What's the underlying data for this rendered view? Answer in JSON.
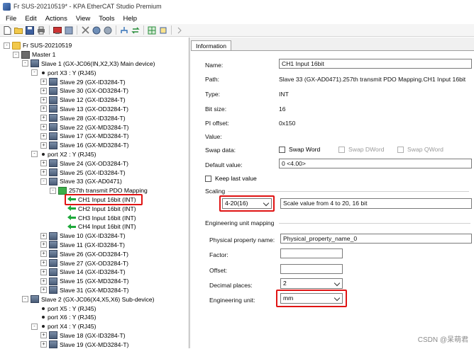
{
  "window": {
    "title": "Fr SUS-20210519* - KPA EtherCAT Studio Premium"
  },
  "menu": [
    {
      "label": "File",
      "name": "menu-file"
    },
    {
      "label": "Edit",
      "name": "menu-edit"
    },
    {
      "label": "Actions",
      "name": "menu-actions"
    },
    {
      "label": "View",
      "name": "menu-view"
    },
    {
      "label": "Tools",
      "name": "menu-tools"
    },
    {
      "label": "Help",
      "name": "menu-help"
    }
  ],
  "tree": [
    {
      "label": "Fr SUS-20210519",
      "icon": "folder",
      "depth": 0,
      "exp": "-"
    },
    {
      "label": "Master 1",
      "icon": "master",
      "depth": 1,
      "exp": "-"
    },
    {
      "label": "Slave 1 (GX-JC06(IN,X2,X3) Main device)",
      "icon": "slave",
      "depth": 2,
      "exp": "-"
    },
    {
      "label": "port X3 : Y (RJ45)",
      "icon": "dot",
      "depth": 3,
      "exp": "-"
    },
    {
      "label": "Slave 29 (GX-ID3284-T)",
      "icon": "slave",
      "depth": 4,
      "exp": "+"
    },
    {
      "label": "Slave 30 (GX-OD3284-T)",
      "icon": "slave",
      "depth": 4,
      "exp": "+"
    },
    {
      "label": "Slave 12 (GX-ID3284-T)",
      "icon": "slave",
      "depth": 4,
      "exp": "+"
    },
    {
      "label": "Slave 13 (GX-OD3284-T)",
      "icon": "slave",
      "depth": 4,
      "exp": "+"
    },
    {
      "label": "Slave 28 (GX-ID3284-T)",
      "icon": "slave",
      "depth": 4,
      "exp": "+"
    },
    {
      "label": "Slave 22 (GX-MD3284-T)",
      "icon": "slave",
      "depth": 4,
      "exp": "+"
    },
    {
      "label": "Slave 17 (GX-MD3284-T)",
      "icon": "slave",
      "depth": 4,
      "exp": "+"
    },
    {
      "label": "Slave 16 (GX-MD3284-T)",
      "icon": "slave",
      "depth": 4,
      "exp": "+"
    },
    {
      "label": "port X2 : Y (RJ45)",
      "icon": "dot",
      "depth": 3,
      "exp": "-"
    },
    {
      "label": "Slave 24 (GX-OD3284-T)",
      "icon": "slave",
      "depth": 4,
      "exp": "+"
    },
    {
      "label": "Slave 25 (GX-ID3284-T)",
      "icon": "slave",
      "depth": 4,
      "exp": "+"
    },
    {
      "label": "Slave 33 (GX-AD0471)",
      "icon": "slave",
      "depth": 4,
      "exp": "-"
    },
    {
      "label": "257th transmit PDO Mapping",
      "icon": "map",
      "depth": 5,
      "exp": "-"
    },
    {
      "label": "CH1 Input 16bit (INT)",
      "icon": "arrow",
      "depth": 6,
      "exp": "",
      "selected": true
    },
    {
      "label": "CH2 Input 16bit (INT)",
      "icon": "arrow",
      "depth": 6,
      "exp": ""
    },
    {
      "label": "CH3 Input 16bit (INT)",
      "icon": "arrow",
      "depth": 6,
      "exp": ""
    },
    {
      "label": "CH4 Input 16bit (INT)",
      "icon": "arrow",
      "depth": 6,
      "exp": ""
    },
    {
      "label": "Slave 10 (GX-ID3284-T)",
      "icon": "slave",
      "depth": 4,
      "exp": "+"
    },
    {
      "label": "Slave 11 (GX-ID3284-T)",
      "icon": "slave",
      "depth": 4,
      "exp": "+"
    },
    {
      "label": "Slave 26 (GX-OD3284-T)",
      "icon": "slave",
      "depth": 4,
      "exp": "+"
    },
    {
      "label": "Slave 27 (GX-OD3284-T)",
      "icon": "slave",
      "depth": 4,
      "exp": "+"
    },
    {
      "label": "Slave 14 (GX-ID3284-T)",
      "icon": "slave",
      "depth": 4,
      "exp": "+"
    },
    {
      "label": "Slave 15 (GX-MD3284-T)",
      "icon": "slave",
      "depth": 4,
      "exp": "+"
    },
    {
      "label": "Slave 31 (GX-MD3284-T)",
      "icon": "slave",
      "depth": 4,
      "exp": "+"
    },
    {
      "label": "Slave 2 (GX-JC06(X4,X5,X6) Sub-device)",
      "icon": "slave",
      "depth": 2,
      "exp": "-"
    },
    {
      "label": "port X5 : Y (RJ45)",
      "icon": "dot",
      "depth": 3,
      "exp": ""
    },
    {
      "label": "port X6 : Y (RJ45)",
      "icon": "dot",
      "depth": 3,
      "exp": ""
    },
    {
      "label": "port X4 : Y (RJ45)",
      "icon": "dot",
      "depth": 3,
      "exp": "-"
    },
    {
      "label": "Slave 18 (GX-ID3284-T)",
      "icon": "slave",
      "depth": 4,
      "exp": "+"
    },
    {
      "label": "Slave 19 (GX-MD3284-T)",
      "icon": "slave",
      "depth": 4,
      "exp": "+"
    }
  ],
  "info": {
    "tab": "Information",
    "name_label": "Name:",
    "name_value": "CH1 Input 16bit",
    "path_label": "Path:",
    "path_value": "Slave 33 (GX-AD0471).257th transmit PDO Mapping.CH1 Input 16bit",
    "type_label": "Type:",
    "type_value": "INT",
    "bitsize_label": "Bit size:",
    "bitsize_value": "16",
    "offset_label": "PI offset:",
    "offset_value": "0x150",
    "value_label": "Value:",
    "swap_label": "Swap data:",
    "swap_word": "Swap Word",
    "swap_dword": "Swap DWord",
    "swap_qword": "Swap QWord",
    "default_label": "Default value:",
    "default_value": "0  <4.00>",
    "keep_last": "Keep last value",
    "scaling_title": "Scaling",
    "scaling_select": "4-20(16)",
    "scaling_desc": "Scale value from 4 to 20, 16 bit",
    "eng_title": "Engineering unit mapping",
    "phys_label": "Physical property name:",
    "phys_value": "Physical_property_name_0",
    "factor_label": "Factor:",
    "factor_value": "",
    "offset2_label": "Offset:",
    "offset2_value": "",
    "decimal_label": "Decimal places:",
    "decimal_value": "2",
    "unit_label": "Engineering unit:",
    "unit_value": "mm"
  },
  "watermark": "CSDN @呆萌君"
}
